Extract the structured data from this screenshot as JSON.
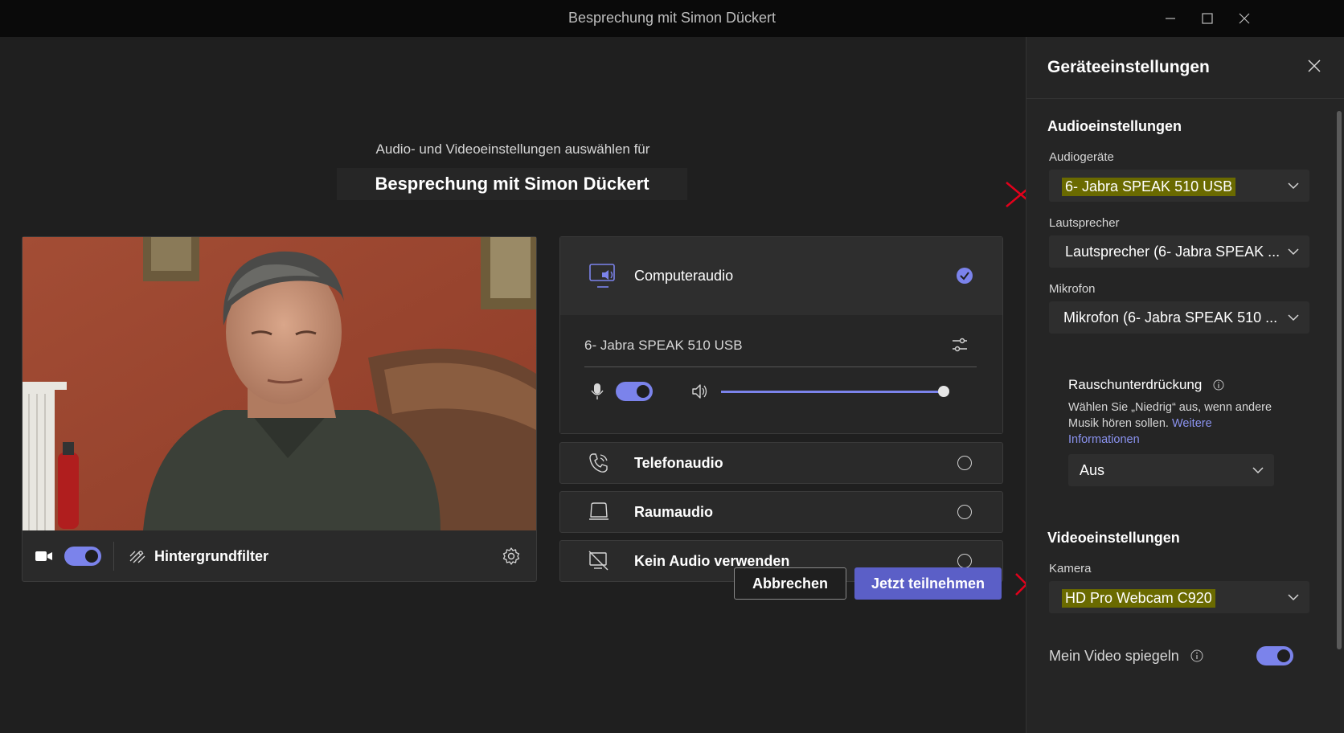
{
  "window": {
    "title": "Besprechung mit Simon Dückert"
  },
  "prejoin": {
    "subtitle": "Audio- und Videoeinstellungen auswählen für",
    "meeting_title": "Besprechung mit Simon Dückert"
  },
  "video": {
    "camera_toggle_on": true,
    "background_filter_label": "Hintergrundfilter"
  },
  "audio_options": {
    "computer_audio": {
      "label": "Computeraudio",
      "selected": true,
      "device": "6- Jabra SPEAK 510 USB",
      "mic_on": true,
      "volume": 1.0
    },
    "phone_audio": {
      "label": "Telefonaudio"
    },
    "room_audio": {
      "label": "Raumaudio"
    },
    "no_audio": {
      "label": "Kein Audio verwenden"
    }
  },
  "buttons": {
    "cancel": "Abbrechen",
    "join": "Jetzt teilnehmen"
  },
  "device_settings": {
    "title": "Geräteeinstellungen",
    "audio_heading": "Audioeinstellungen",
    "audio_devices_label": "Audiogeräte",
    "audio_devices_value": "6- Jabra SPEAK 510 USB",
    "speaker_label": "Lautsprecher",
    "speaker_value": "Lautsprecher (6- Jabra SPEAK ...",
    "mic_label": "Mikrofon",
    "mic_value": "Mikrofon (6- Jabra SPEAK 510 ...",
    "noise_label": "Rauschunterdrückung",
    "noise_desc": "Wählen Sie „Niedrig“ aus, wenn andere Musik hören sollen.",
    "noise_link": "Weitere Informationen",
    "noise_value": "Aus",
    "video_heading": "Videoeinstellungen",
    "camera_label": "Kamera",
    "camera_value": "HD Pro Webcam C920",
    "mirror_label": "Mein Video spiegeln",
    "mirror_on": true
  },
  "colors": {
    "accent": "#7b83eb",
    "button_primary": "#5b5fc7",
    "highlight_text": "#ffff33",
    "annotation_red": "#e3001b"
  }
}
